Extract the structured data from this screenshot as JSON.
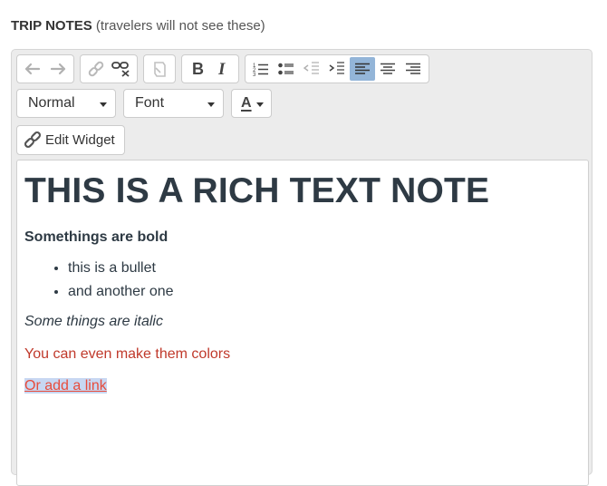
{
  "section": {
    "title": "TRIP NOTES",
    "subtitle": "(travelers will not see these)"
  },
  "toolbar": {
    "groups": [
      {
        "name": "history",
        "buttons": [
          {
            "icon": "undo-icon",
            "enabled": false
          },
          {
            "icon": "redo-icon",
            "enabled": false
          }
        ]
      },
      {
        "name": "links",
        "buttons": [
          {
            "icon": "link-icon",
            "enabled": false
          },
          {
            "icon": "unlink-icon",
            "enabled": true
          }
        ]
      },
      {
        "name": "clear",
        "buttons": [
          {
            "icon": "clear-format-icon",
            "enabled": false
          }
        ]
      },
      {
        "name": "text-style",
        "buttons": [
          {
            "icon": "bold-icon",
            "enabled": true
          },
          {
            "icon": "italic-icon",
            "enabled": true
          }
        ]
      },
      {
        "name": "paragraph",
        "buttons": [
          {
            "icon": "ordered-list-icon",
            "enabled": true
          },
          {
            "icon": "bullet-list-icon",
            "enabled": true
          },
          {
            "icon": "outdent-icon",
            "enabled": false
          },
          {
            "icon": "indent-icon",
            "enabled": true
          },
          {
            "icon": "align-left-icon",
            "enabled": true,
            "active": true
          },
          {
            "icon": "align-center-icon",
            "enabled": true
          },
          {
            "icon": "align-right-icon",
            "enabled": true
          }
        ]
      }
    ],
    "format_select": "Normal",
    "font_select": "Font",
    "text_color_label": "A",
    "edit_widget_label": "Edit Widget",
    "active_color": "#93b5d8"
  },
  "content": {
    "heading": "THIS IS A RICH TEXT NOTE",
    "bold_text": "Somethings are bold",
    "bullets": [
      "this is a bullet",
      "and another one"
    ],
    "italic_text": "Some things are italic",
    "colored_text": "You can even make them colors",
    "colored_text_color": "#c0392b",
    "link_text": "Or add a link",
    "link_color": "#e74c3c"
  }
}
